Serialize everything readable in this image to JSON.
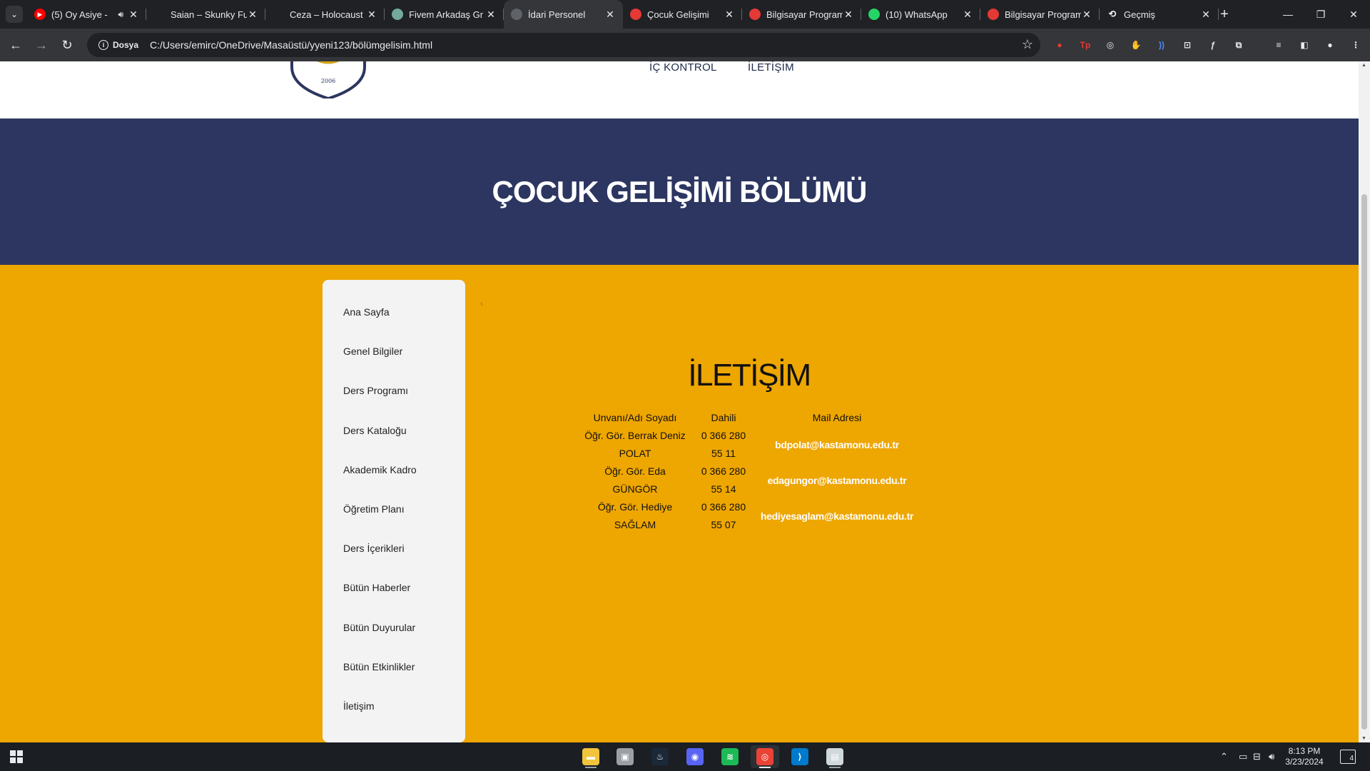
{
  "browser": {
    "tabs": [
      {
        "title": "(5) Oy Asiye - ",
        "favicon": "youtube-icon",
        "color": "#ff0000",
        "audio": true
      },
      {
        "title": "Saian – Skunky Fu",
        "favicon": "none",
        "color": "#202124"
      },
      {
        "title": "Ceza – Holocaust",
        "favicon": "none",
        "color": "#202124"
      },
      {
        "title": "Fivem Arkadaş Gr",
        "favicon": "chatgpt-icon",
        "color": "#74aa9c"
      },
      {
        "title": "İdari Personel",
        "favicon": "file-icon",
        "color": "#5f6368",
        "active": true
      },
      {
        "title": "Çocuk Gelişimi",
        "favicon": "university-icon",
        "color": "#e53935"
      },
      {
        "title": "Bilgisayar Program",
        "favicon": "university-icon",
        "color": "#e53935"
      },
      {
        "title": "(10) WhatsApp",
        "favicon": "whatsapp-icon",
        "color": "#25d366"
      },
      {
        "title": "Bilgisayar Program",
        "favicon": "university-icon",
        "color": "#e53935"
      },
      {
        "title": "Geçmiş",
        "favicon": "history-icon",
        "color": "#202124"
      }
    ],
    "chip_label": "Dosya",
    "url": "C:/Users/emirc/OneDrive/Masaüstü/yyeni123/bölümgelisim.html",
    "extensions": [
      {
        "name": "adblock-icon",
        "glyph": "●",
        "color": "#e53935"
      },
      {
        "name": "tp-extension-icon",
        "glyph": "Tp",
        "color": "#e53935"
      },
      {
        "name": "chatgpt-extension-icon",
        "glyph": "◎",
        "color": "#e8eaed"
      },
      {
        "name": "hand-extension-icon",
        "glyph": "✋",
        "color": "#e53935"
      },
      {
        "name": "sound-extension-icon",
        "glyph": "))",
        "color": "#4c8bf5"
      },
      {
        "name": "screenshot-extension-icon",
        "glyph": "⊡",
        "color": "#e8eaed"
      },
      {
        "name": "font-extension-icon",
        "glyph": "ƒ",
        "color": "#e8eaed"
      },
      {
        "name": "puzzle-extensions-icon",
        "glyph": "⧉",
        "color": "#e8eaed"
      },
      {
        "name": "media-control-icon",
        "glyph": "≡",
        "color": "#e8eaed"
      },
      {
        "name": "side-panel-icon",
        "glyph": "◧",
        "color": "#e8eaed"
      },
      {
        "name": "profile-avatar-icon",
        "glyph": "●",
        "color": "#e8eaed"
      },
      {
        "name": "kebab-menu-icon",
        "glyph": "⋮",
        "color": "#e8eaed"
      }
    ]
  },
  "site": {
    "logo_year": "2006",
    "top_nav": [
      "İÇ KONTROL",
      "İLETİŞİM"
    ],
    "banner_title": "ÇOCUK GELİŞİMİ BÖLÜMÜ",
    "sidebar": [
      "Ana Sayfa",
      "Genel Bilgiler",
      "Ders Programı",
      "Ders Kataloğu",
      "Akademik Kadro",
      "Öğretim Planı",
      "Ders İçerikleri",
      "Bütün Haberler",
      "Bütün Duyurular",
      "Bütün Etkinlikler",
      "İletişim"
    ],
    "sidebar_toggle": "‹",
    "contact": {
      "title": "İLETİŞİM",
      "headers": [
        "Unvanı/Adı Soyadı",
        "Dahili",
        "Mail Adresi"
      ],
      "rows": [
        {
          "name": "Öğr. Gör. Berrak Deniz POLAT",
          "phone": "0 366 280 55 11",
          "mail": "bdpolat@kastamonu.edu.tr"
        },
        {
          "name": "Öğr. Gör. Eda GÜNGÖR",
          "phone": "0 366 280 55 14",
          "mail": "edagungor@kastamonu.edu.tr"
        },
        {
          "name": "Öğr. Gör. Hediye SAĞLAM",
          "phone": "0 366 280 55 07",
          "mail": "hediyesaglam@kastamonu.edu.tr"
        }
      ]
    }
  },
  "colors": {
    "banner": "#2c3660",
    "page_background": "#eea600",
    "sidebar": "#f3f3f3"
  },
  "taskbar": {
    "apps": [
      {
        "name": "file-explorer-icon",
        "color": "#f2c43d",
        "glyph": "▬"
      },
      {
        "name": "finder-app-icon",
        "color": "#9aa0a6",
        "glyph": "▣"
      },
      {
        "name": "steam-icon",
        "color": "#1b2838",
        "glyph": "♨"
      },
      {
        "name": "discord-icon",
        "color": "#5865f2",
        "glyph": "◉"
      },
      {
        "name": "spotify-icon",
        "color": "#1db954",
        "glyph": "≋"
      },
      {
        "name": "chrome-icon",
        "color": "#ea4335",
        "glyph": "◎",
        "active": true
      },
      {
        "name": "vscode-icon",
        "color": "#007acc",
        "glyph": "⟩"
      },
      {
        "name": "notepad-icon",
        "color": "#cfd8dc",
        "glyph": "▤"
      }
    ],
    "time": "8:13 PM",
    "date": "3/23/2024",
    "notifications": "4"
  }
}
